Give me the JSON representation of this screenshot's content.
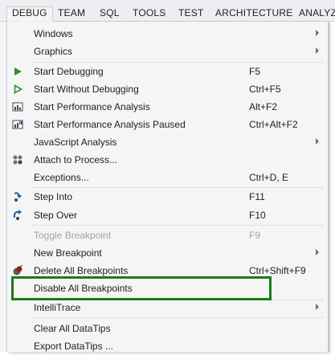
{
  "menubar": {
    "items": [
      {
        "label": "DEBUG"
      },
      {
        "label": "TEAM"
      },
      {
        "label": "SQL"
      },
      {
        "label": "TOOLS"
      },
      {
        "label": "TEST"
      },
      {
        "label": "ARCHITECTURE"
      },
      {
        "label": "ANALYZ"
      }
    ]
  },
  "menu": {
    "items": [
      {
        "label": "Windows",
        "shortcut": "",
        "submenu": true
      },
      {
        "label": "Graphics",
        "shortcut": "",
        "submenu": true
      },
      {
        "label": "Start Debugging",
        "shortcut": "F5",
        "icon": "play-icon"
      },
      {
        "label": "Start Without Debugging",
        "shortcut": "Ctrl+F5",
        "icon": "play-outline-icon"
      },
      {
        "label": "Start Performance Analysis",
        "shortcut": "Alt+F2",
        "icon": "performance-icon"
      },
      {
        "label": "Start Performance Analysis Paused",
        "shortcut": "Ctrl+Alt+F2",
        "icon": "performance-paused-icon"
      },
      {
        "label": "JavaScript Analysis",
        "shortcut": "",
        "submenu": true
      },
      {
        "label": "Attach to Process...",
        "shortcut": "",
        "icon": "attach-process-icon"
      },
      {
        "label": "Exceptions...",
        "shortcut": "Ctrl+D, E"
      },
      {
        "label": "Step Into",
        "shortcut": "F11",
        "icon": "step-into-icon"
      },
      {
        "label": "Step Over",
        "shortcut": "F10",
        "icon": "step-over-icon"
      },
      {
        "label": "Toggle Breakpoint",
        "shortcut": "F9",
        "disabled": true
      },
      {
        "label": "New Breakpoint",
        "shortcut": "",
        "submenu": true
      },
      {
        "label": "Delete All Breakpoints",
        "shortcut": "Ctrl+Shift+F9",
        "icon": "delete-breakpoints-icon"
      },
      {
        "label": "Disable All Breakpoints",
        "shortcut": ""
      },
      {
        "label": "IntelliTrace",
        "shortcut": "",
        "submenu": true
      },
      {
        "label": "Clear All DataTips",
        "shortcut": ""
      },
      {
        "label": "Export DataTips ...",
        "shortcut": ""
      }
    ]
  },
  "colors": {
    "menu_bg": "#f5f5f5",
    "menubar_bg": "#eeeef2",
    "highlight_border": "#1c7a1c",
    "play_green": "#388a34",
    "step_blue": "#1e5ba8",
    "disabled_text": "#a2a4a5"
  }
}
